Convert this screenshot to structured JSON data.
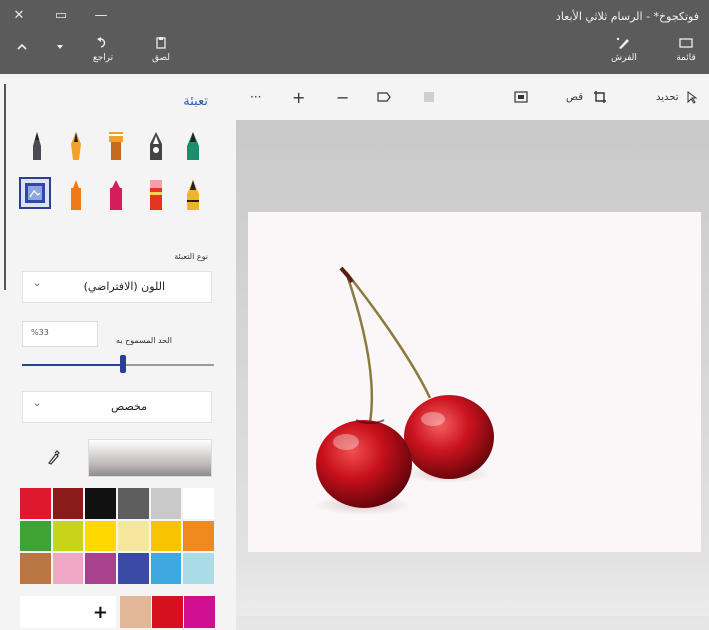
{
  "window": {
    "title": "فوتكجوخ* - الرسام ثلاثي الأبعاد",
    "controls": {
      "close": "✕",
      "restore": "▭",
      "minimize": "—"
    }
  },
  "toolbar": {
    "menu_label": "قائمة",
    "brushes_label": "الفرش",
    "paste_label": "لصق",
    "undo_label": "تراجع"
  },
  "edit_toolbar": {
    "select_label": "تحديد",
    "crop_label": "قص",
    "more_label": "···",
    "zoom_in": "+",
    "zoom_out": "−"
  },
  "panel": {
    "title": "تعبئة",
    "brush_icons": [
      "marker-icon",
      "calligraphy-pen-icon",
      "oil-brush-icon",
      "watercolor-icon",
      "pixel-pen-icon",
      "pencil-icon",
      "eraser-icon",
      "crayon-icon",
      "spray-can-icon",
      "fill-icon"
    ],
    "fill_type_label": "نوع التعبئة",
    "fill_type_value": "اللون (الافتراضي)",
    "tolerance_label": "الحد المسموح به",
    "tolerance_value": "%33",
    "tolerance_fraction": 0.33,
    "custom_label": "مخصص",
    "add_color_label": "+"
  },
  "palette": {
    "colors": [
      "#e0182d",
      "#8b1a1a",
      "#111111",
      "#5e5e5e",
      "#c9c9c9",
      "#ffffff",
      "#3ea332",
      "#c8d41a",
      "#ffd800",
      "#f5e79e",
      "#f8c300",
      "#f08a1c",
      "#b97542",
      "#f0a7c6",
      "#a8428f",
      "#3b4aa5",
      "#40a8e0",
      "#a9dce4"
    ],
    "custom_colors": [
      "#e2b797",
      "#d6101e",
      "#cf0f8f"
    ]
  }
}
